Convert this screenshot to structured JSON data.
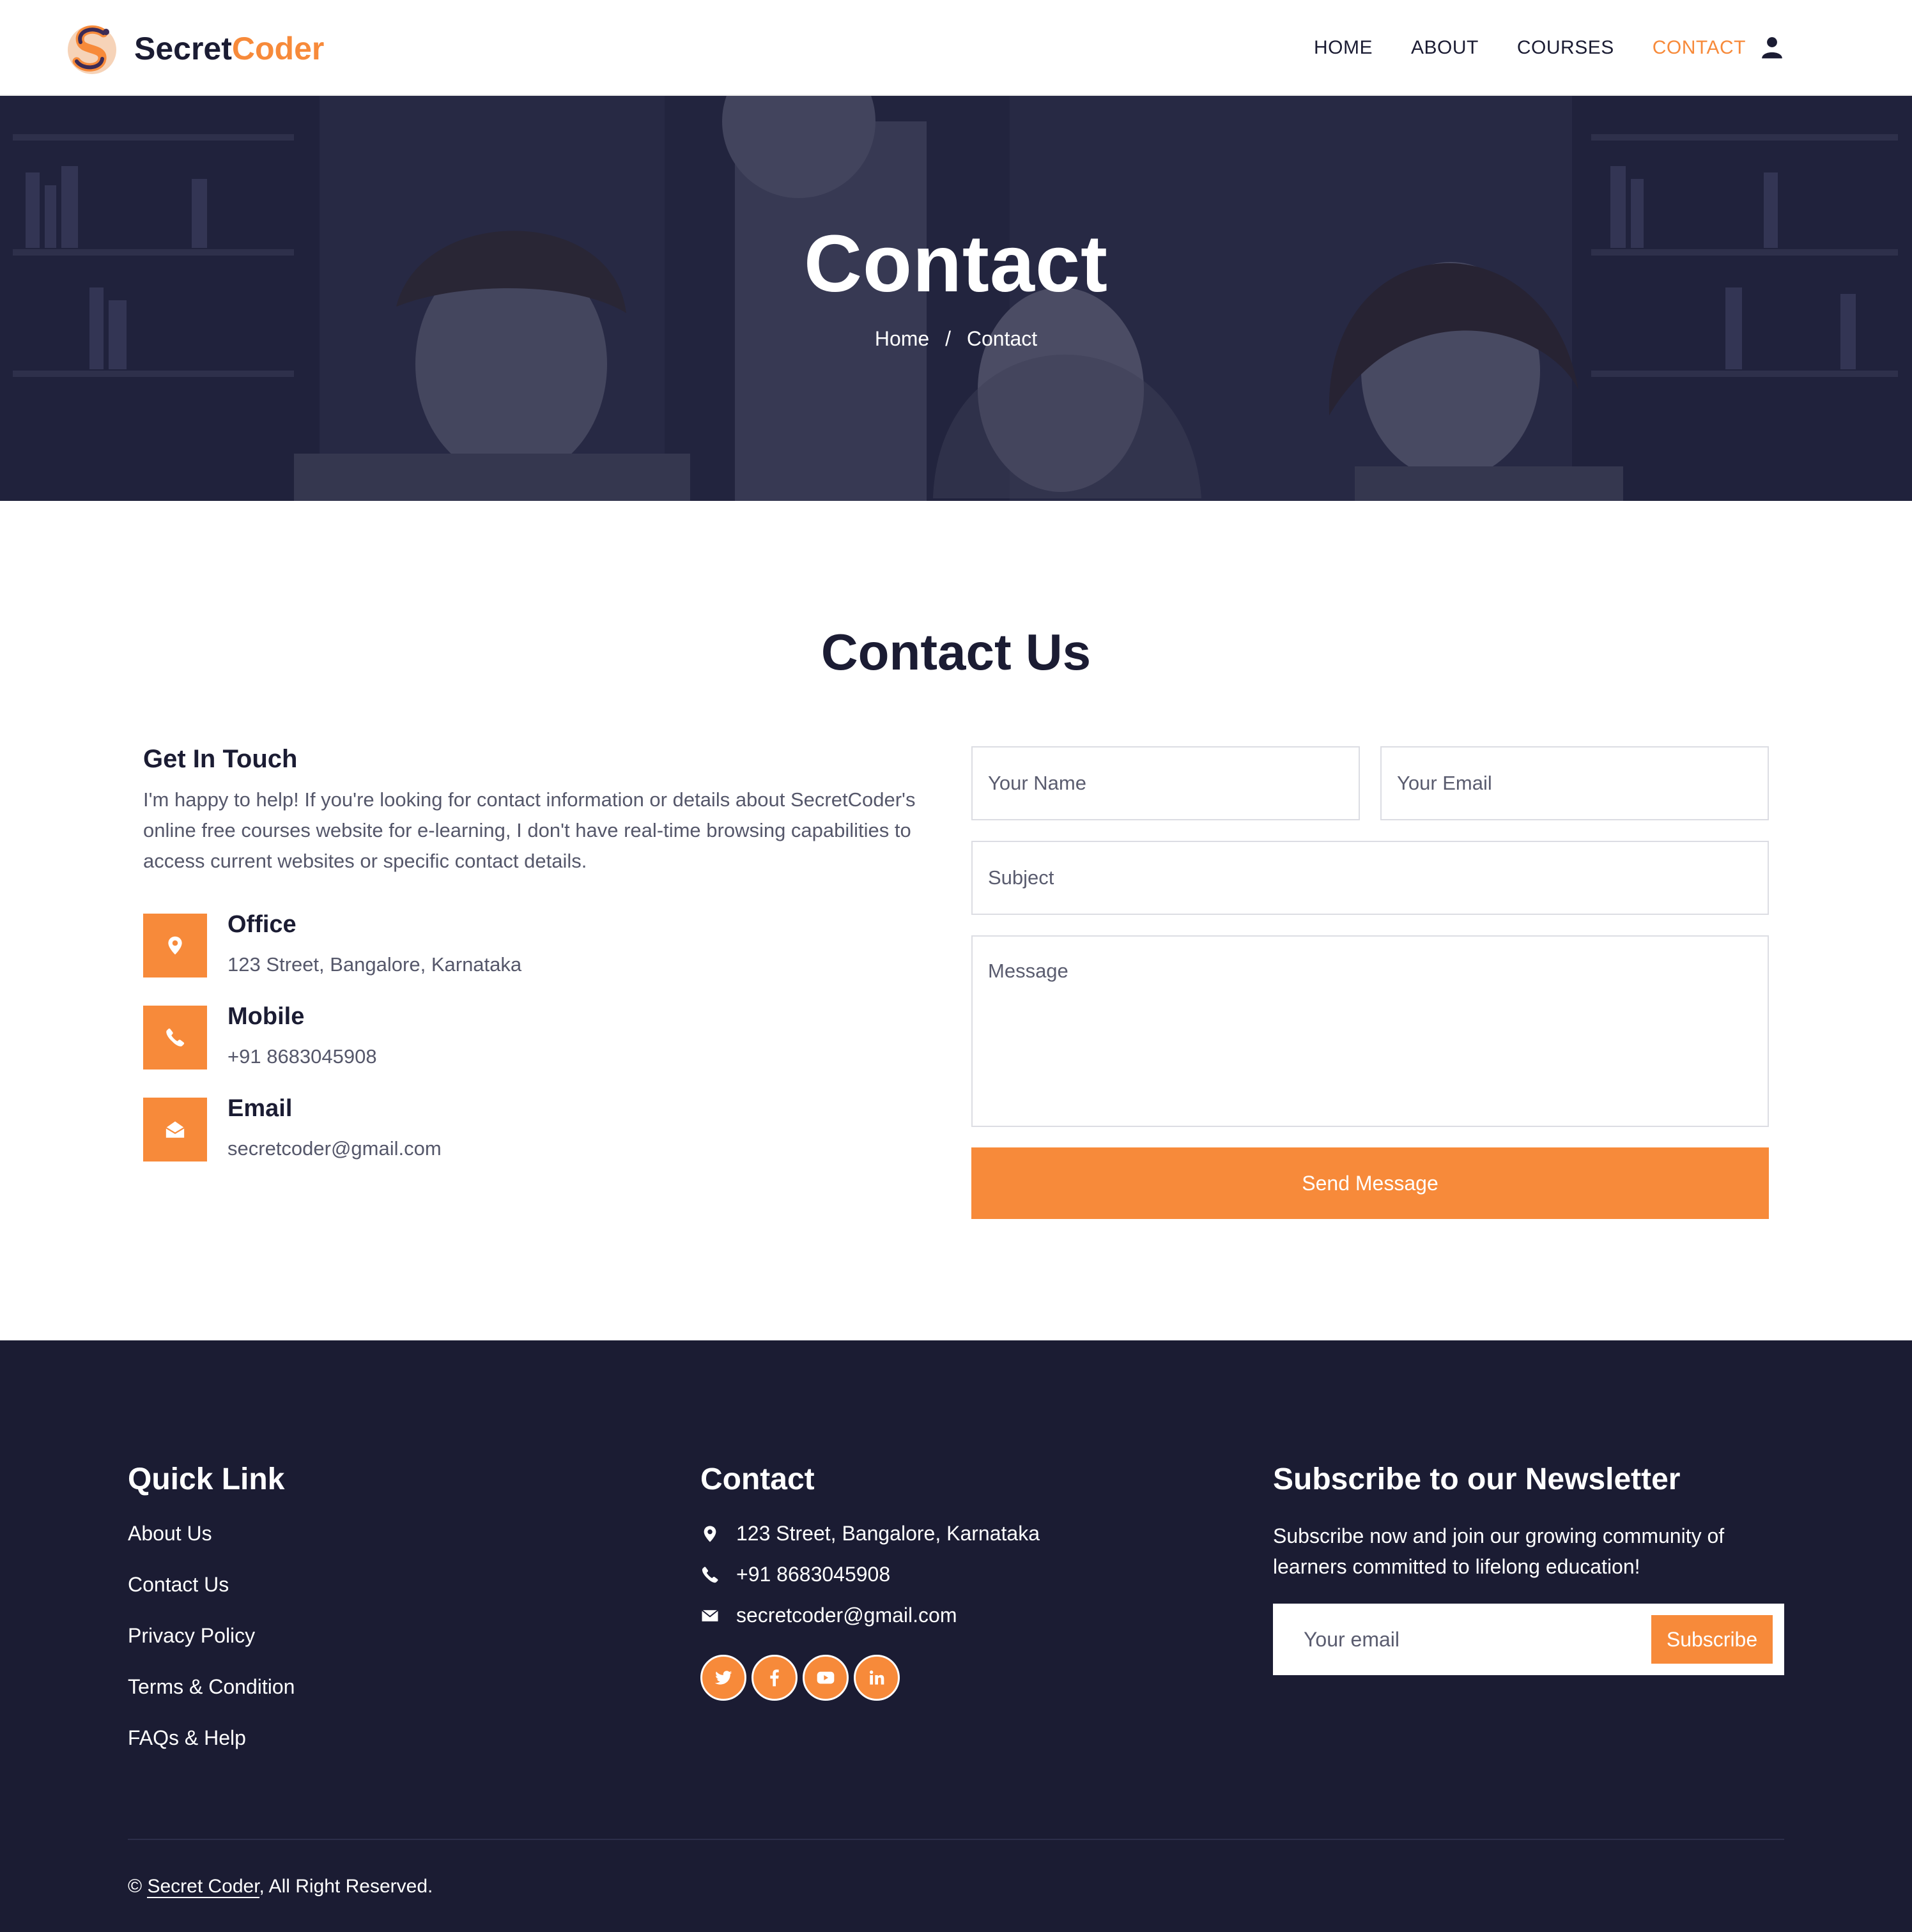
{
  "brand": {
    "part1": "Secret",
    "part2": "Coder"
  },
  "nav": {
    "items": [
      {
        "label": "HOME"
      },
      {
        "label": "ABOUT"
      },
      {
        "label": "COURSES"
      },
      {
        "label": "CONTACT"
      }
    ],
    "active": "CONTACT",
    "user_icon": "user-icon"
  },
  "hero": {
    "title": "Contact",
    "breadcrumb": {
      "home": "Home",
      "separator": "/",
      "current": "Contact"
    }
  },
  "contact": {
    "section_title": "Contact Us",
    "get_in_touch": {
      "title": "Get In Touch",
      "text": "I'm happy to help! If you're looking for contact information or details about SecretCoder's online free courses website for e-learning, I don't have real-time browsing capabilities to access current websites or specific contact details."
    },
    "info": [
      {
        "icon": "map-pin-icon",
        "label": "Office",
        "value": "123 Street, Bangalore, Karnataka"
      },
      {
        "icon": "phone-icon",
        "label": "Mobile",
        "value": "+91 8683045908"
      },
      {
        "icon": "envelope-open-icon",
        "label": "Email",
        "value": "secretcoder@gmail.com"
      }
    ],
    "form": {
      "name_placeholder": "Your Name",
      "email_placeholder": "Your Email",
      "subject_placeholder": "Subject",
      "message_placeholder": "Message",
      "submit_label": "Send Message"
    }
  },
  "footer": {
    "quick_link": {
      "title": "Quick Link",
      "links": [
        "About Us",
        "Contact Us",
        "Privacy Policy",
        "Terms & Condition",
        "FAQs & Help"
      ]
    },
    "contact": {
      "title": "Contact",
      "address": "123 Street, Bangalore, Karnataka",
      "phone": "+91 8683045908",
      "email": "secretcoder@gmail.com",
      "socials": [
        "twitter-icon",
        "facebook-icon",
        "youtube-icon",
        "linkedin-icon"
      ]
    },
    "newsletter": {
      "title": "Subscribe to our Newsletter",
      "text": "Subscribe now and join our growing community of learners committed to lifelong education!",
      "placeholder": "Your email",
      "button": "Subscribe"
    },
    "copyright": {
      "symbol": "©",
      "brand": "Secret Coder",
      "suffix": ", All Right Reserved."
    }
  },
  "colors": {
    "accent": "#f78a3a",
    "navy": "#1b1c33",
    "text_muted": "#55576a",
    "white": "#ffffff"
  }
}
